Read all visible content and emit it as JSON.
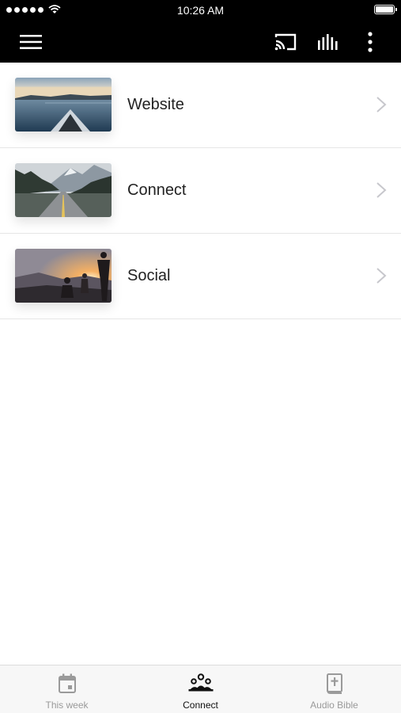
{
  "status_bar": {
    "time": "10:26 AM"
  },
  "app_bar": {
    "icons": [
      "menu-icon",
      "cast-icon",
      "audio-bars-icon",
      "more-vert-icon"
    ]
  },
  "list": {
    "items": [
      {
        "label": "Website",
        "thumbnail": "lake-kayak-photo"
      },
      {
        "label": "Connect",
        "thumbnail": "mountain-road-photo"
      },
      {
        "label": "Social",
        "thumbnail": "sunset-people-photo"
      }
    ]
  },
  "tab_bar": {
    "tabs": [
      {
        "label": "This week",
        "icon": "calendar-icon",
        "active": false
      },
      {
        "label": "Connect",
        "icon": "people-icon",
        "active": true
      },
      {
        "label": "Audio Bible",
        "icon": "bible-icon",
        "active": false
      }
    ]
  },
  "colors": {
    "header": "#000000",
    "active_tab": "#111111",
    "inactive_tab": "#9a9a9a"
  }
}
